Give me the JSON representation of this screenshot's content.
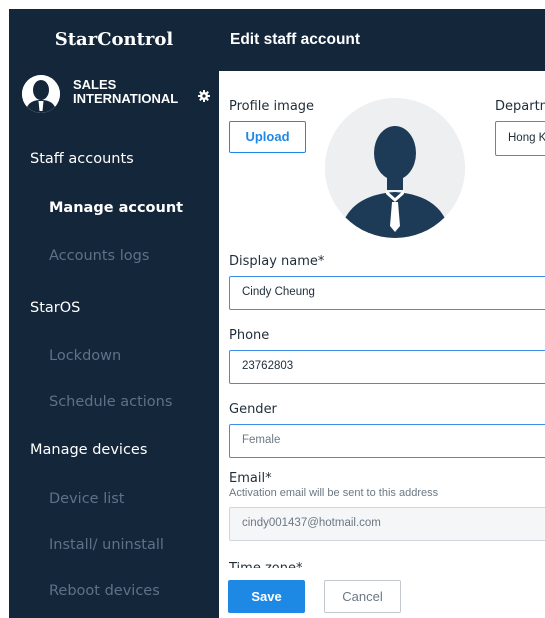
{
  "sidebar": {
    "brand": "StarControl",
    "account_name": "SALES INTERNATIONAL",
    "nav": [
      {
        "label": "Staff accounts",
        "type": "section"
      },
      {
        "label": "Manage account",
        "type": "sub",
        "active": true
      },
      {
        "label": "Accounts logs",
        "type": "sub"
      },
      {
        "label": "StarOS",
        "type": "section"
      },
      {
        "label": "Lockdown",
        "type": "sub"
      },
      {
        "label": "Schedule actions",
        "type": "sub"
      },
      {
        "label": "Manage devices",
        "type": "section"
      },
      {
        "label": "Device list",
        "type": "sub"
      },
      {
        "label": "Install/ uninstall",
        "type": "sub"
      },
      {
        "label": "Reboot devices",
        "type": "sub"
      }
    ]
  },
  "header": {
    "title": "Edit staff account"
  },
  "form": {
    "profile_image_label": "Profile image",
    "upload_label": "Upload",
    "department_label": "Departm",
    "department_value": "Hong K",
    "display_name_label": "Display name*",
    "display_name_value": "Cindy Cheung",
    "phone_label": "Phone",
    "phone_value": "23762803",
    "gender_label": "Gender",
    "gender_value": "Female",
    "email_label": "Email*",
    "email_hint": "Activation email will be sent to this address",
    "email_value": "cindy001437@hotmail.com",
    "timezone_label": "Time zone*"
  },
  "footer": {
    "save_label": "Save",
    "cancel_label": "Cancel"
  },
  "icons": {
    "gear": "gear-icon",
    "avatar": "user-silhouette-icon"
  },
  "colors": {
    "sidebar_bg": "#13263a",
    "accent": "#1e88e5",
    "field_border": "#3d8ee6"
  }
}
